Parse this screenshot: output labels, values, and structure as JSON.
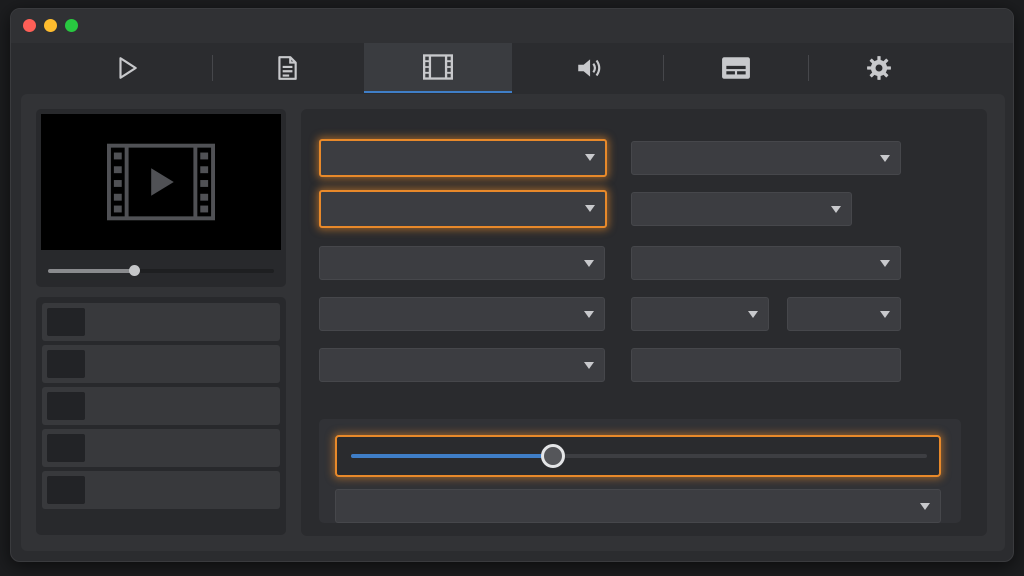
{
  "window": {
    "traffic_lights": [
      "close",
      "minimize",
      "zoom"
    ]
  },
  "tabs": [
    {
      "id": "play",
      "icon": "play-icon",
      "active": false
    },
    {
      "id": "document",
      "icon": "document-icon",
      "active": false
    },
    {
      "id": "video",
      "icon": "film-icon",
      "active": true
    },
    {
      "id": "audio",
      "icon": "speaker-icon",
      "active": false
    },
    {
      "id": "subtitles",
      "icon": "subtitles-icon",
      "active": false
    },
    {
      "id": "settings",
      "icon": "gear-icon",
      "active": false
    }
  ],
  "preview": {
    "icon": "film-play-icon",
    "scrubber_progress": 0.38
  },
  "queue": {
    "item_count": 5
  },
  "video_settings": {
    "quality_slider_value": 0.35
  },
  "colors": {
    "accent_blue": "#3f7ec7",
    "focus_orange": "#e8892a",
    "window_bg": "#2b2c2f",
    "panel_bg": "#2a2b2e"
  }
}
